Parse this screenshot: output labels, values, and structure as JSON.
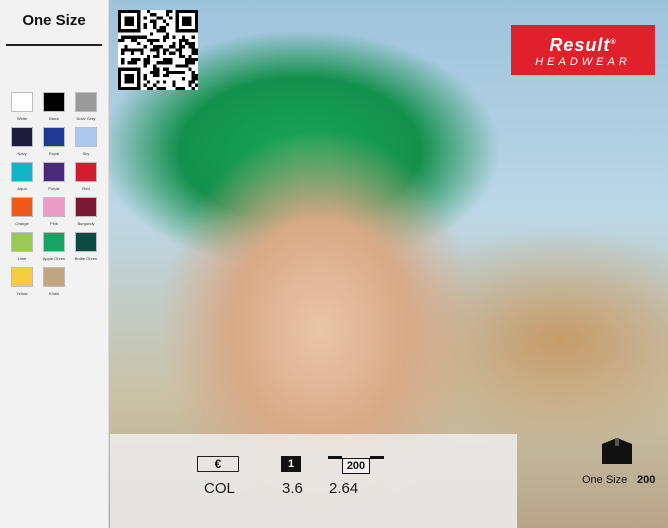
{
  "sidebar": {
    "size_title": "One Size",
    "colours": [
      {
        "name": "White",
        "hex": "#ffffff"
      },
      {
        "name": "Black",
        "hex": "#000000"
      },
      {
        "name": "Dove Grey",
        "hex": "#9a9a9a"
      },
      {
        "name": "Navy",
        "hex": "#1f1d3d"
      },
      {
        "name": "Royal",
        "hex": "#1e3a94"
      },
      {
        "name": "Sky",
        "hex": "#a9c8ee"
      },
      {
        "name": "Aqua",
        "hex": "#12b5c8"
      },
      {
        "name": "Purple",
        "hex": "#4a2a78"
      },
      {
        "name": "Red",
        "hex": "#d21b2b"
      },
      {
        "name": "Orange",
        "hex": "#ee5a1b"
      },
      {
        "name": "Pink",
        "hex": "#ec9cc6"
      },
      {
        "name": "Burgundy",
        "hex": "#7a1836"
      },
      {
        "name": "Lime",
        "hex": "#9ac95a"
      },
      {
        "name": "Apple Green",
        "hex": "#1aa262"
      },
      {
        "name": "Bottle Green",
        "hex": "#0c4a42"
      },
      {
        "name": "Yellow",
        "hex": "#f7cc3f"
      },
      {
        "name": "Khaki",
        "hex": "#c2a682"
      }
    ]
  },
  "qr_icon": "qr-code",
  "logo": {
    "brand": "Result",
    "sub": "HEADWEAR",
    "registered": "®",
    "bg_color": "#e0202a"
  },
  "pricing": {
    "currency_label": "€",
    "single_label": "1",
    "carton_label": "200",
    "country": "COL",
    "price_single": "3.6",
    "price_carton": "2.64"
  },
  "packaging": {
    "icon": "box-icon",
    "size": "One Size",
    "quantity": "200"
  }
}
